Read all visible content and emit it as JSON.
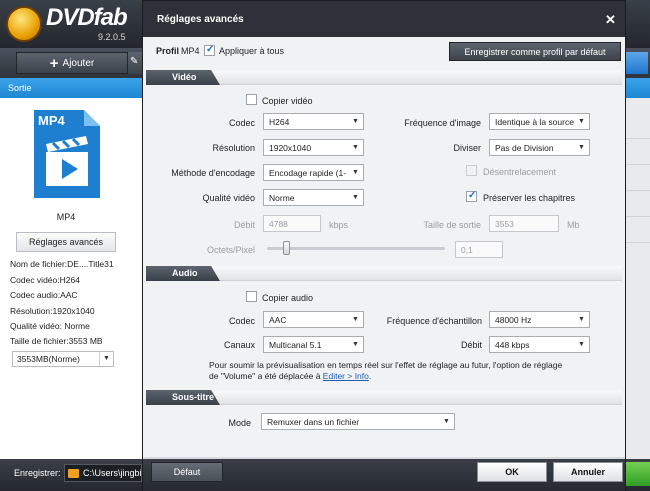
{
  "app": {
    "logo_text": "DVDfab",
    "version": "9.2.0.5",
    "toolbar": {
      "add_label": "Ajouter"
    },
    "sortie_label": "Sortie",
    "file": {
      "icon_label": "MP4",
      "format_label": "MP4",
      "advanced_button": "Réglages avancés",
      "info": [
        "Nom de fichier:DE....Title31",
        "Codec vidéo:H264",
        "Codec audio:AAC",
        "Résolution:1920x1040",
        "Qualité vidéo: Norme",
        "Taille de fichier:3553 MB"
      ],
      "size_select": "3553MB(Norme)"
    },
    "bottom": {
      "save_label": "Enregistrer:",
      "folder_path": "C:\\Users\\jingbi"
    }
  },
  "dialog": {
    "title": "Réglages avancés",
    "profile": {
      "label": "Profil",
      "value": "MP4",
      "apply_all_label": "Appliquer à tous",
      "apply_all_checked": true,
      "save_default_button": "Enregistrer comme profil par défaut"
    },
    "video": {
      "section_title": "Vidéo",
      "copy_video_label": "Copier vidéo",
      "copy_video_checked": false,
      "codec": {
        "label": "Codec",
        "value": "H264"
      },
      "resolution": {
        "label": "Résolution",
        "value": "1920x1040"
      },
      "encoding_method": {
        "label": "Méthode d'encodage",
        "value": "Encodage rapide (1-"
      },
      "video_quality": {
        "label": "Qualité vidéo",
        "value": "Norme"
      },
      "frame_rate": {
        "label": "Fréquence d'image",
        "value": "Identique à la source"
      },
      "divide": {
        "label": "Diviser",
        "value": "Pas de Division"
      },
      "deinterlace_label": "Désentrelacement",
      "deinterlace_checked": false,
      "preserve_chapters_label": "Préserver les chapitres",
      "preserve_chapters_checked": true,
      "bitrate": {
        "label": "Débit",
        "value": "4788",
        "unit": "kbps"
      },
      "output_size": {
        "label": "Taille de sortie",
        "value": "3553",
        "unit": "Mb"
      },
      "bits_per_pixel": {
        "label": "Octets/Pixel",
        "value": "0,1"
      }
    },
    "audio": {
      "section_title": "Audio",
      "copy_audio_label": "Copier audio",
      "copy_audio_checked": false,
      "codec": {
        "label": "Codec",
        "value": "AAC"
      },
      "channels": {
        "label": "Canaux",
        "value": "Multicanal 5.1"
      },
      "sample_rate": {
        "label": "Fréquence d'échantillon",
        "value": "48000 Hz"
      },
      "bitrate": {
        "label": "Débit",
        "value": "448 kbps"
      },
      "note_line1": "Pour soumir la prévisualisation en temps réel sur l'effet de réglage au futur, l'option de réglage",
      "note_line2_prefix": "de \"Volume\" a été déplacée à ",
      "note_link": "Editer > Info",
      "note_line2_suffix": "."
    },
    "subtitle": {
      "section_title": "Sous-titre",
      "mode": {
        "label": "Mode",
        "value": "Remuxer dans un fichier"
      }
    },
    "footer": {
      "default_button": "Défaut",
      "ok_button": "OK",
      "cancel_button": "Annuler"
    }
  }
}
